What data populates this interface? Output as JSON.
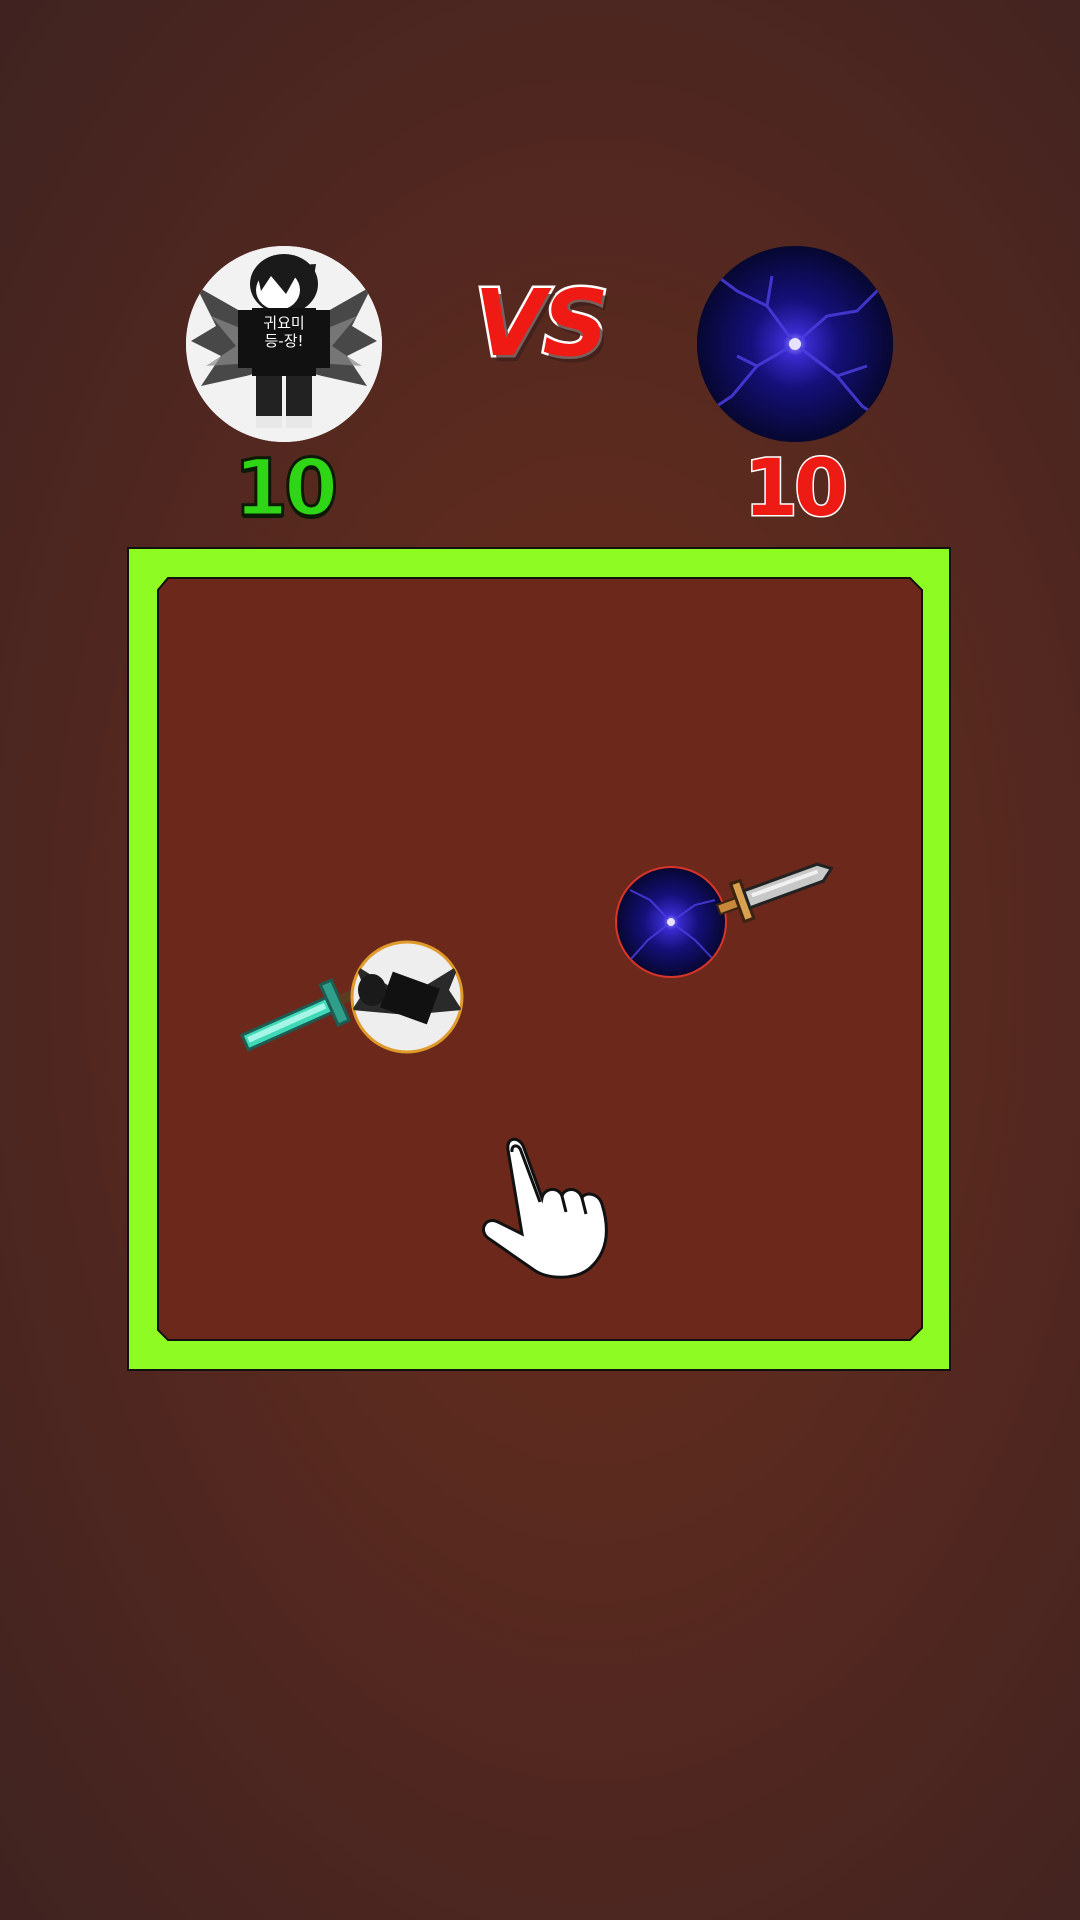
{
  "match": {
    "vs_label": "VS",
    "player_one": {
      "score": "10",
      "score_color": "#2fd615",
      "avatar_icon": "monochrome-character-avatar-icon",
      "weapon_icon": "diamond-sword-icon"
    },
    "player_two": {
      "score": "10",
      "score_color": "#ee1b14",
      "avatar_icon": "purple-lightning-orb-icon",
      "weapon_icon": "iron-sword-icon"
    }
  },
  "arena": {
    "border_color": "#8efc23"
  },
  "hint": {
    "icon": "tap-hand-icon"
  }
}
